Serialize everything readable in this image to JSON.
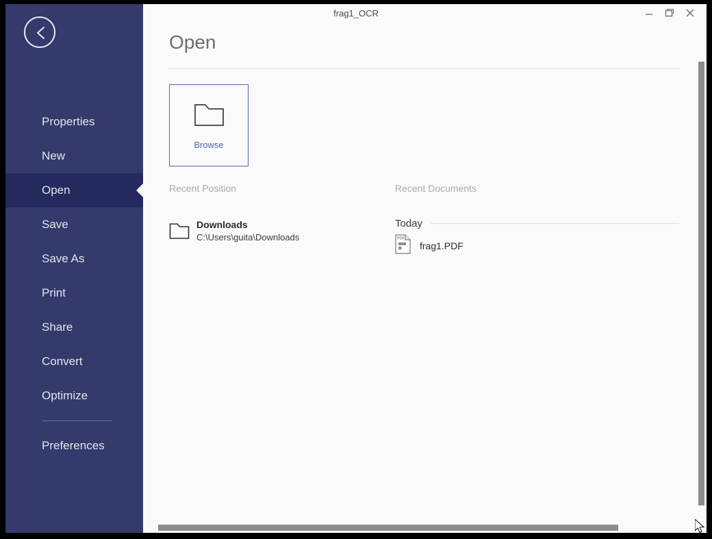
{
  "window": {
    "title": "frag1_OCR",
    "controls": {
      "minimize": "minimize-icon",
      "restore": "restore-icon",
      "close": "close-icon"
    }
  },
  "sidebar": {
    "back_button": "back-chevron-icon",
    "items": [
      {
        "label": "Properties",
        "selected": false
      },
      {
        "label": "New",
        "selected": false
      },
      {
        "label": "Open",
        "selected": true
      },
      {
        "label": "Save",
        "selected": false
      },
      {
        "label": "Save As",
        "selected": false
      },
      {
        "label": "Print",
        "selected": false
      },
      {
        "label": "Share",
        "selected": false
      },
      {
        "label": "Convert",
        "selected": false
      },
      {
        "label": "Optimize",
        "selected": false
      }
    ],
    "footer_items": [
      {
        "label": "Preferences",
        "selected": false
      }
    ],
    "colors": {
      "background": "#343a6b",
      "selected": "#252a5e",
      "text": "#e3e4ee"
    }
  },
  "main": {
    "page_title": "Open",
    "browse": {
      "label": "Browse",
      "icon": "folder-icon",
      "accent": "#4d5fb5"
    },
    "recent_position": {
      "heading": "Recent Position",
      "items": [
        {
          "name": "Downloads",
          "path": "C:\\Users\\guita\\Downloads",
          "icon": "folder-icon"
        }
      ]
    },
    "recent_documents": {
      "heading": "Recent Documents",
      "groups": [
        {
          "label": "Today",
          "items": [
            {
              "name": "frag1.PDF",
              "icon": "pdf-file-icon"
            }
          ]
        }
      ]
    }
  },
  "scrollbars": {
    "vertical": "vertical-scrollbar",
    "horizontal": "horizontal-scrollbar"
  }
}
